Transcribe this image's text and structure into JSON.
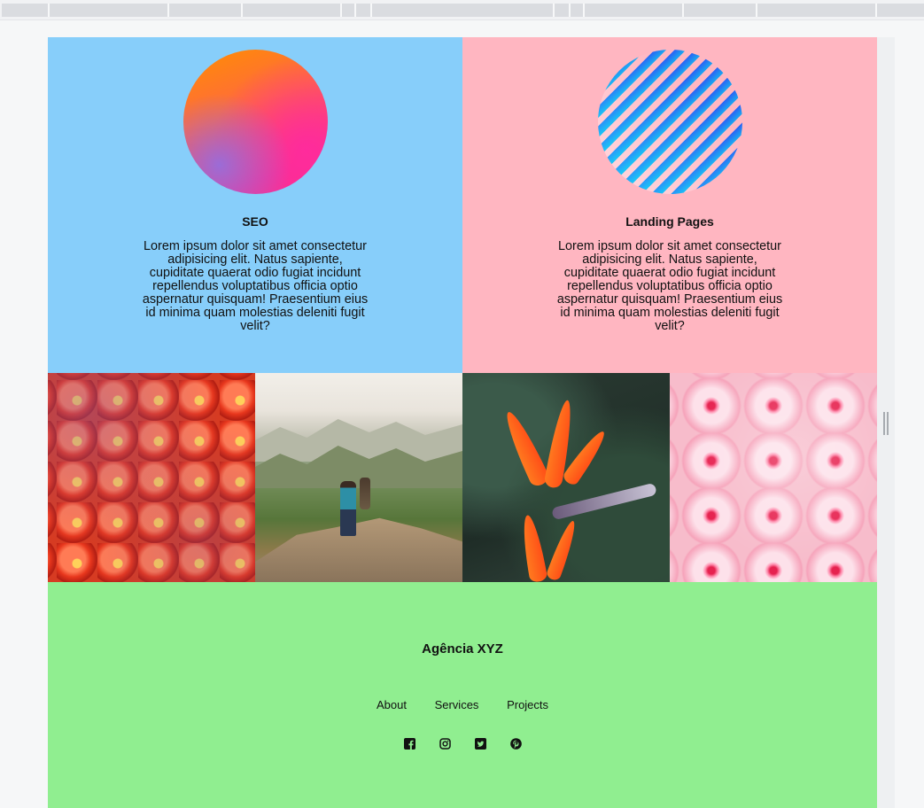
{
  "services": [
    {
      "title": "SEO",
      "text": "Lorem ipsum dolor sit amet consectetur adipisicing elit. Natus sapiente, cupiditate quaerat odio fugiat incidunt repellendus voluptatibus officia optio aspernatur quisquam! Praesentium eius id minima quam molestias deleniti fugit velit?",
      "background": "#87cefa"
    },
    {
      "title": "Landing Pages",
      "text": "Lorem ipsum dolor sit amet consectetur adipisicing elit. Natus sapiente, cupiditate quaerat odio fugiat incidunt repellendus voluptatibus officia optio aspernatur quisquam! Praesentium eius id minima quam molestias deleniti fugit velit?",
      "background": "#ffb6c1"
    }
  ],
  "gallery": [
    "tomatoes-photo",
    "mountain-hiker-photo",
    "bird-of-paradise-photo",
    "pink-blossom-photo"
  ],
  "footer": {
    "brand": "Agência XYZ",
    "background": "#90ee90",
    "nav": [
      "About",
      "Services",
      "Projects"
    ],
    "social_icons": [
      "facebook-icon",
      "instagram-icon",
      "twitter-icon",
      "pinterest-icon"
    ]
  }
}
